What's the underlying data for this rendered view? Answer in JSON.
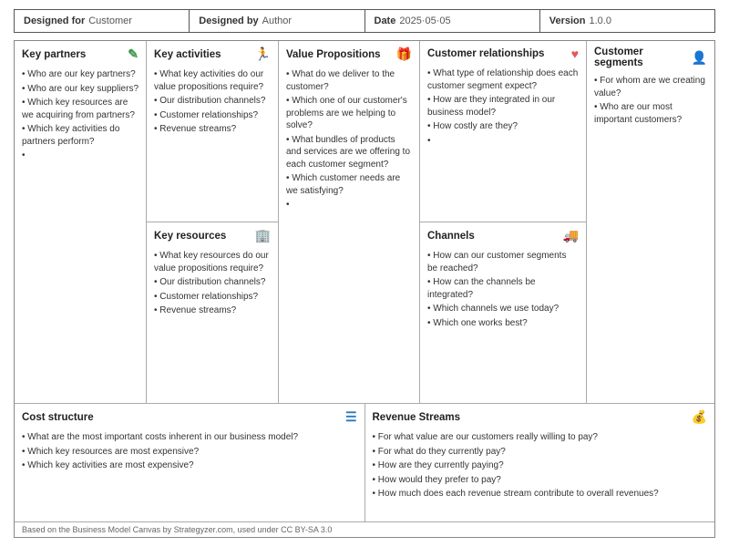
{
  "header": {
    "designed_for_label": "Designed for",
    "designed_for_value": "Customer",
    "designed_by_label": "Designed by",
    "designed_by_value": "Author",
    "date_label": "Date",
    "date_value": "2025·05·05",
    "version_label": "Version",
    "version_value": "1.0.0"
  },
  "sections": {
    "key_partners": {
      "title": "Key partners",
      "items": [
        "Who are our key partners?",
        "Who are our key suppliers?",
        "Which key resources are we acquiring from partners?",
        "Which key activities do partners perform?"
      ]
    },
    "key_activities": {
      "title": "Key activities",
      "items": [
        "What key activities do our value propositions require?",
        "Our distribution channels?",
        "Customer relationships?",
        "Revenue streams?"
      ]
    },
    "key_resources": {
      "title": "Key resources",
      "items": [
        "What key resources do our value propositions require?",
        "Our distribution channels?",
        "Customer relationships?",
        "Revenue streams?"
      ]
    },
    "value_propositions": {
      "title": "Value Propositions",
      "items": [
        "What do we deliver to the customer?",
        "Which one of our customer's problems are we helping to solve?",
        "What bundles of products and services are we offering to each customer segment?",
        "Which customer needs are we satisfying?"
      ]
    },
    "customer_relationships": {
      "title": "Customer relationships",
      "items": [
        "What type of relationship does each customer segment expect?",
        "How are they integrated in our business model?",
        "How costly are they?"
      ]
    },
    "channels": {
      "title": "Channels",
      "items": [
        "How can our customer segments be reached?",
        "How can the channels be integrated?",
        "Which channels we use today?",
        "Which one works best?"
      ]
    },
    "customer_segments": {
      "title": "Customer segments",
      "items": [
        "For whom are we creating value?",
        "Who are our most important customers?"
      ]
    },
    "cost_structure": {
      "title": "Cost structure",
      "items": [
        "What are the most important costs inherent in our business model?",
        "Which key resources are most expensive?",
        "Which key activities are most expensive?"
      ]
    },
    "revenue_streams": {
      "title": "Revenue Streams",
      "items": [
        "For what value are our customers really willing to pay?",
        "For what do they currently pay?",
        "How are they currently paying?",
        "How would they prefer to pay?",
        "How much does each revenue stream contribute to overall revenues?"
      ]
    }
  },
  "footer": {
    "text": "Based on the Business Model Canvas by Strategyzer.com, used under CC BY-SA 3.0"
  }
}
